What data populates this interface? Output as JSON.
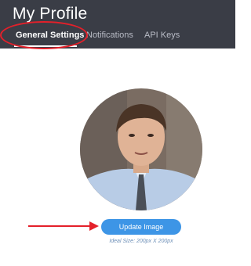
{
  "header": {
    "title": "My Profile",
    "tabs": [
      {
        "label": "General Settings",
        "active": true
      },
      {
        "label": "Notifications",
        "active": false
      },
      {
        "label": "API Keys",
        "active": false
      }
    ]
  },
  "profile": {
    "avatar_alt": "",
    "update_button_label": "Update Image",
    "size_hint": "Ideal Size: 200px X 200px"
  },
  "annotations": {
    "highlight_color": "#e4202a"
  },
  "colors": {
    "header_bg": "#3a3d46",
    "accent": "#3d95e6"
  }
}
